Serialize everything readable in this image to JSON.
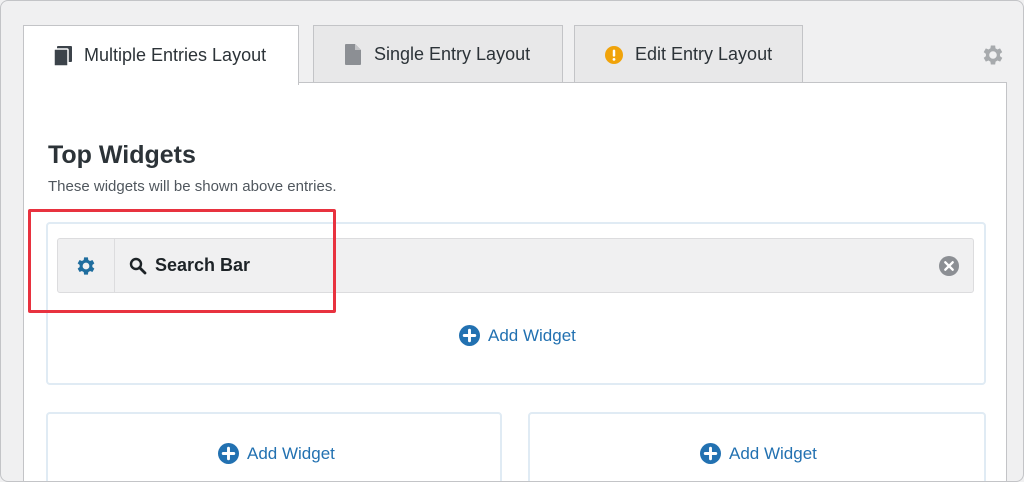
{
  "tabs": [
    {
      "label": "Multiple Entries Layout",
      "icon": "book-icon",
      "active": true
    },
    {
      "label": "Single Entry Layout",
      "icon": "document-icon",
      "active": false
    },
    {
      "label": "Edit Entry Layout",
      "icon": "warning-icon",
      "active": false
    }
  ],
  "section": {
    "title": "Top Widgets",
    "description": "These widgets will be shown above entries."
  },
  "widget": {
    "label": "Search Bar",
    "icon": "search-icon"
  },
  "add_widget_label": "Add Widget",
  "colors": {
    "accent": "#2271b1",
    "warning": "#f0a30a",
    "highlight": "#e8323f",
    "gear": "#1f6d9e"
  }
}
